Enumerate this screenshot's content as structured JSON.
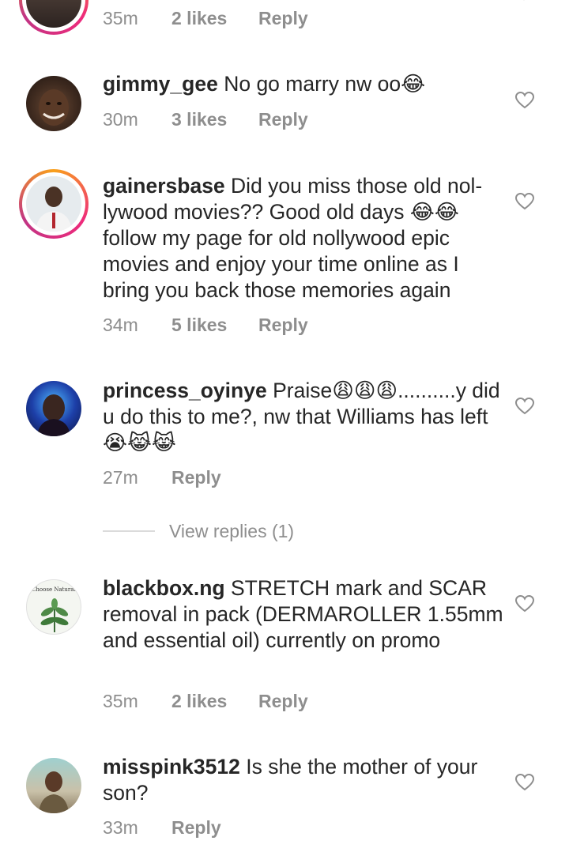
{
  "comments": [
    {
      "user": "",
      "text": "",
      "time": "35m",
      "likes": "2 likes",
      "reply": "Reply"
    },
    {
      "user": "gimmy_gee",
      "text": "No go marry nw oo😂",
      "time": "30m",
      "likes": "3 likes",
      "reply": "Reply"
    },
    {
      "user": "gainersbase",
      "text": "Did you miss those old nol-lywood movies?? Good old days 😂😂 follow my page for old nollywood epic movies and enjoy your time online as I bring you back those memories again",
      "time": "34m",
      "likes": "5 likes",
      "reply": "Reply"
    },
    {
      "user": "princess_oyinye",
      "text": "Praise😩😩😩..........y did u do this to me?, nw that Williams has left 😭😹😹",
      "time": "27m",
      "likes": "",
      "reply": "Reply",
      "view_replies": "View replies (1)"
    },
    {
      "user": "blackbox.ng",
      "text": "STRETCH mark and SCAR removal in pack (DERMAROLLER 1.55mm and essential oil) currently on promo",
      "time": "35m",
      "likes": "2 likes",
      "reply": "Reply",
      "avatar_text": "Choose Natural."
    },
    {
      "user": "misspink3512",
      "text": "Is she the mother of your son?",
      "time": "33m",
      "likes": "",
      "reply": "Reply"
    }
  ],
  "icons": {
    "like": "heart-outline-icon",
    "collapse": "chevron-icon"
  },
  "colors": {
    "text": "#262626",
    "meta": "#8e8e8e",
    "story_ring": [
      "#f9a11b",
      "#ee2a7b",
      "#c13584"
    ]
  }
}
